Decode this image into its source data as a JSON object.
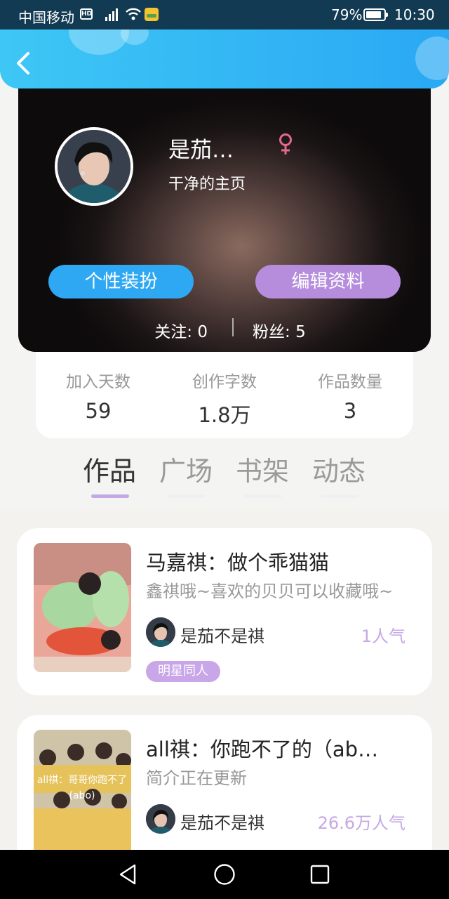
{
  "status_bar": {
    "carrier": "中国移动",
    "hd": "HD",
    "battery": "79%",
    "time": "10:30"
  },
  "header": {
    "back_icon": "chevron-left-icon"
  },
  "profile": {
    "name": "是茄…",
    "gender_icon": "female-icon",
    "bio": "干净的主页",
    "dress_button": "个性装扮",
    "edit_button": "编辑资料",
    "following_label": "关注:",
    "following_count": "0",
    "fans_label": "粉丝:",
    "fans_count": "5"
  },
  "stats": [
    {
      "label": "加入天数",
      "value": "59"
    },
    {
      "label": "创作字数",
      "value": "1.8万"
    },
    {
      "label": "作品数量",
      "value": "3"
    }
  ],
  "tabs": [
    {
      "label": "作品",
      "active": true
    },
    {
      "label": "广场",
      "active": false
    },
    {
      "label": "书架",
      "active": false
    },
    {
      "label": "动态",
      "active": false
    }
  ],
  "works": [
    {
      "title": "马嘉祺：做个乖猫猫",
      "desc": "鑫祺哦~喜欢的贝贝可以收藏哦~",
      "author": "是茄不是祺",
      "popularity": "1人气",
      "tag": "明星同人"
    },
    {
      "title": "all祺：你跑不了的（ab…",
      "desc": "简介正在更新",
      "author": "是茄不是祺",
      "popularity": "26.6万人气",
      "cover_text": "all祺：哥哥你跑不了(abo)"
    }
  ],
  "colors": {
    "accent_blue": "#2fa8f3",
    "accent_purple": "#b58ddc",
    "tag_purple": "#c8a6e8"
  }
}
